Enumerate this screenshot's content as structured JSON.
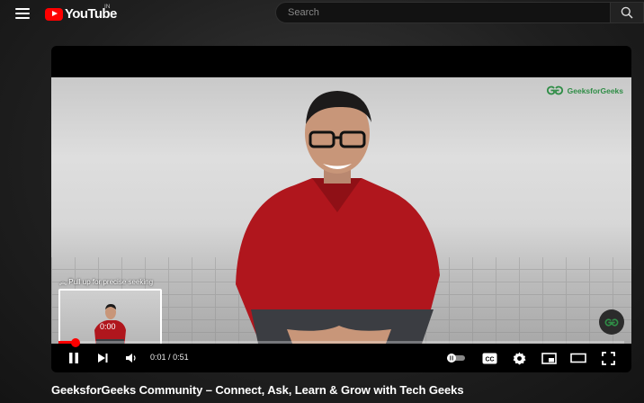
{
  "header": {
    "menu_icon": "hamburger-menu-icon",
    "logo_text": "YouTube",
    "region": "IN",
    "search_placeholder": "Search",
    "search_icon": "search-icon"
  },
  "player": {
    "watermark": "GeeksforGeeks",
    "seek_hint": "Pull up for precise seeking",
    "preview_time": "0:00",
    "current_time": "0:01",
    "separator": "/",
    "duration": "0:51",
    "progress_fraction": 0.03,
    "accent": "#ff0000",
    "brand_green": "#2f8d46",
    "controls": {
      "play_pause": "pause-icon",
      "next": "skip-next-icon",
      "volume": "volume-icon",
      "autoplay": "autoplay-toggle-icon",
      "captions": "cc-icon",
      "settings": "gear-icon",
      "miniplayer": "miniplayer-icon",
      "theater": "theater-mode-icon",
      "fullscreen": "fullscreen-icon"
    }
  },
  "video": {
    "title": "GeeksforGeeks Community – Connect, Ask, Learn & Grow with Tech Geeks"
  }
}
